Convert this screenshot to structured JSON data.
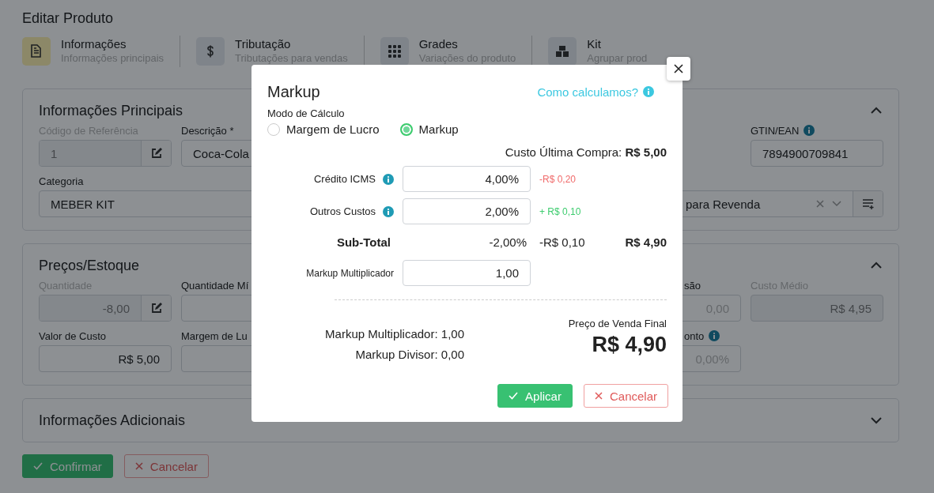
{
  "page": {
    "title": "Editar Produto"
  },
  "steps": [
    {
      "title": "Informações",
      "subtitle": "Informações principais",
      "selected": true
    },
    {
      "title": "Tributação",
      "subtitle": "Tributações para vendas",
      "selected": false
    },
    {
      "title": "Grades",
      "subtitle": "Variações do produto",
      "selected": false
    },
    {
      "title": "Kit",
      "subtitle": "Agrupar prod",
      "selected": false
    }
  ],
  "sections": [
    {
      "title": "Informações Principais",
      "expanded": true,
      "rows": [
        [
          {
            "label": "Código de Referência",
            "value": "1",
            "kind": "edit",
            "disabled": true
          },
          {
            "label": "Descrição *",
            "value": "Coca-Cola",
            "kind": "text",
            "disabled": false
          },
          {
            "label": "GTIN/EAN",
            "info": true,
            "value": "7894900709841",
            "kind": "text",
            "disabled": false
          }
        ],
        [
          {
            "label": "Categoria",
            "value": "MEBER KIT",
            "kind": "select",
            "disabled": false
          },
          {
            "value": "para Revenda",
            "kind": "select-add",
            "disabled": false
          }
        ]
      ]
    },
    {
      "title": "Preços/Estoque",
      "expanded": true,
      "rows": [
        [
          {
            "label": "Quantidade",
            "value": "-8,00",
            "kind": "edit",
            "disabled": true
          },
          {
            "label": "Quantidade Mí",
            "kind": "number",
            "disabled": false
          },
          {
            "label": "são",
            "placeholder": "0,00",
            "kind": "number",
            "disabled": false
          },
          {
            "label": "Custo Médio",
            "value": "R$ 4,95",
            "kind": "number",
            "disabled": true
          }
        ],
        [
          {
            "label": "Valor de Custo",
            "value": "R$ 5,00",
            "kind": "number",
            "disabled": false
          },
          {
            "label": "Margem de Lu",
            "kind": "number",
            "disabled": false
          },
          {
            "label": "onto",
            "info": true,
            "placeholder": "0,00%",
            "kind": "number",
            "disabled": false
          }
        ]
      ]
    },
    {
      "title": "Informações Adicionais",
      "expanded": false
    }
  ],
  "actions": [
    {
      "label": "Confirmar",
      "kind": "primary"
    },
    {
      "label": "Cancelar",
      "kind": "secondary"
    }
  ],
  "modal": {
    "title": "Markup",
    "help_link": "Como calculamos?",
    "mode_label": "Modo de Cálculo",
    "modes": [
      {
        "label": "Margem de Lucro",
        "selected": false
      },
      {
        "label": "Markup",
        "selected": true
      }
    ],
    "last_cost": "Custo Última Compra: **R$ 5,00**",
    "adjustments": [
      {
        "label": "Crédito ICMS",
        "value": "4,00%",
        "delta": "-R$ 0,20",
        "color": "#f06a6a"
      },
      {
        "label": "Outros Custos",
        "value": "2,00%",
        "delta": "+ R$ 0,10",
        "color": "#3dcc6e"
      }
    ],
    "subtotal": {
      "label": "Sub-Total",
      "percent": "-2,00%",
      "amount": "-R$ 0,10",
      "total": "R$ 4,90"
    },
    "multiplier": {
      "label": "Markup Multiplicador",
      "value": "1,00"
    },
    "summary": [
      "Markup Multiplicador: 1,00",
      "Markup Divisor: 0,00"
    ],
    "final": {
      "label": "Preço de Venda Final",
      "value": "R$ 4,90"
    },
    "buttons": [
      {
        "label": "Aplicar",
        "kind": "primary"
      },
      {
        "label": "Cancelar",
        "kind": "secondary"
      }
    ]
  }
}
